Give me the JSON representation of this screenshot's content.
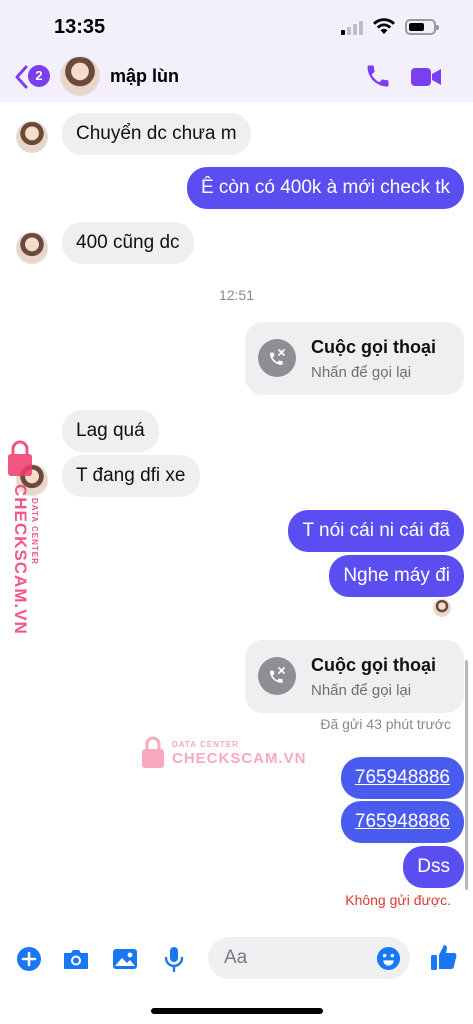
{
  "status": {
    "time": "13:35"
  },
  "header": {
    "back_badge": "2",
    "contact_name": "mập lùn"
  },
  "messages": [
    {
      "side": "in",
      "text": "Chuyển dc chưa m"
    },
    {
      "side": "out",
      "text": "Ê còn có 400k à mới check tk"
    },
    {
      "side": "in",
      "text": "400 cũng dc"
    },
    {
      "side": "in",
      "text": "Lag quá"
    },
    {
      "side": "in",
      "text": "T đang dfi xe"
    },
    {
      "side": "out",
      "text": "T nói cái ni cái đã"
    },
    {
      "side": "out",
      "text": "Nghe máy đi"
    },
    {
      "side": "out",
      "text": "765948886"
    },
    {
      "side": "out",
      "text": "765948886"
    },
    {
      "side": "out",
      "text": "Dss"
    }
  ],
  "timestamp": "12:51",
  "calls": [
    {
      "title": "Cuộc gọi thoại",
      "subtitle": "Nhấn để gọi lại"
    },
    {
      "title": "Cuộc gọi thoại",
      "subtitle": "Nhấn để gọi lại"
    }
  ],
  "sent_status": "Đã gửi 43 phút trước",
  "error_text": "Không gửi được.",
  "composer": {
    "placeholder": "Aa"
  },
  "watermark": {
    "brand": "CHECKSCAM.VN",
    "tag": "DATA CENTER"
  },
  "colors": {
    "accent": "#7b3ff2",
    "bubble_out": "#5a4ef0",
    "bubble_in": "#efeff1",
    "error": "#e0392f",
    "composer_icon": "#1877f2"
  },
  "icons": [
    "back-chevron-icon",
    "phone-icon",
    "video-camera-icon",
    "plus-icon",
    "camera-icon",
    "image-icon",
    "microphone-icon",
    "emoji-icon",
    "thumbs-up-icon",
    "missed-call-icon"
  ]
}
